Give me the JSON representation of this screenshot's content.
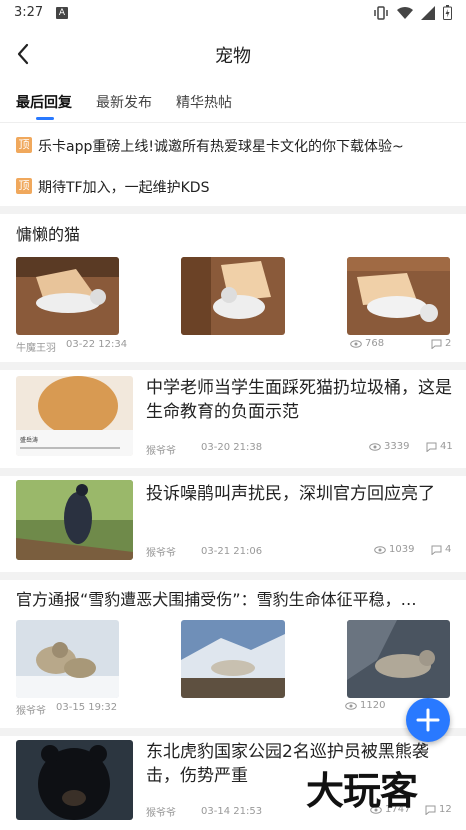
{
  "status_bar": {
    "time": "3:27",
    "notif": "A"
  },
  "header": {
    "title": "宠物"
  },
  "tabs": [
    {
      "label": "最后回复",
      "active": true
    },
    {
      "label": "最新发布",
      "active": false
    },
    {
      "label": "精华热帖",
      "active": false
    }
  ],
  "pinned": [
    {
      "badge": "顶",
      "text": "乐卡app重磅上线!诚邀所有热爱球星卡文化的你下载体验~"
    },
    {
      "badge": "顶",
      "text": "期待TF加入，一起维护KDS"
    }
  ],
  "posts": [
    {
      "title": "慵懒的猫",
      "author": "牛魔王羽",
      "date": "03-22 12:34",
      "views": "768",
      "comments": "2"
    },
    {
      "title": "中学老师当学生面踩死猫扔垃圾桶，这是生命教育的负面示范",
      "author": "猴爷爷",
      "date": "03-20 21:38",
      "views": "3339",
      "comments": "41"
    },
    {
      "title": "投诉噪鹃叫声扰民，深圳官方回应亮了",
      "author": "猴爷爷",
      "date": "03-21 21:06",
      "views": "1039",
      "comments": "4"
    },
    {
      "title": "官方通报“雪豹遭恶犬围捕受伤”：雪豹生命体征平稳，…",
      "author": "猴爷爷",
      "date": "03-15 19:32",
      "views": "1120",
      "comments": ""
    },
    {
      "title": "东北虎豹国家公园2名巡护员被黑熊袭击，伤势严重",
      "author": "猴爷爷",
      "date": "03-14 21:53",
      "views": "1747",
      "comments": "12"
    }
  ],
  "thumb_caption": "盛岳涛",
  "watermark": "大玩客",
  "colors": {
    "accent": "#2979ff",
    "pin": "#f0a85c"
  }
}
